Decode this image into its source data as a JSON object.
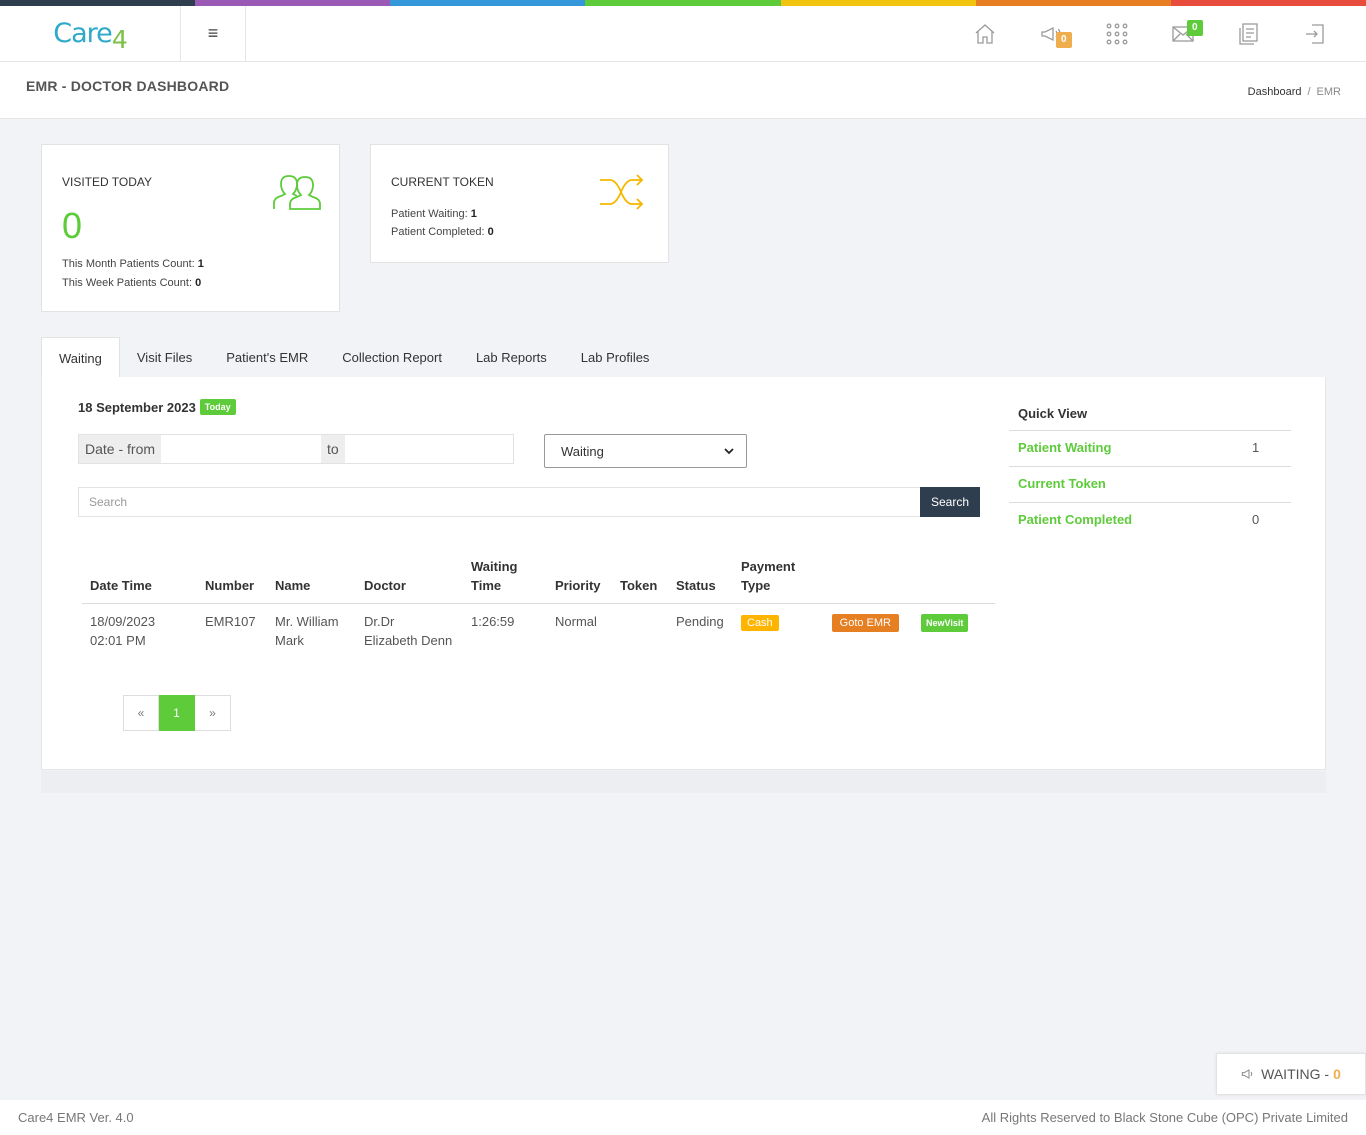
{
  "brand": {
    "logo_text": "Care",
    "logo_suffix": "4",
    "strip_colors": [
      "#2f3e4e",
      "#9b59b6",
      "#3498db",
      "#5ecb3b",
      "#f1c40f",
      "#e67e22",
      "#e74c3c"
    ]
  },
  "topbar": {
    "menu_icon": "≡",
    "announce_count": "0",
    "messages_count": "0"
  },
  "header": {
    "title": "EMR - DOCTOR DASHBOARD",
    "breadcrumb": {
      "first": "Dashboard",
      "separator": "/",
      "current": "EMR"
    }
  },
  "stats": {
    "visited": {
      "title": "VISITED TODAY",
      "count": "0",
      "month_label": "This Month Patients Count:",
      "month_value": "1",
      "week_label": "This Week Patients Count:",
      "week_value": "0"
    },
    "token": {
      "title": "CURRENT TOKEN",
      "waiting_label": "Patient Waiting:",
      "waiting_value": "1",
      "completed_label": "Patient Completed:",
      "completed_value": "0"
    }
  },
  "tabs": [
    "Waiting",
    "Visit Files",
    "Patient's EMR",
    "Collection Report",
    "Lab Reports",
    "Lab Profiles"
  ],
  "waiting": {
    "date": "18 September 2023",
    "today_label": "Today",
    "date_from_label": "Date - from",
    "date_to_label": "to",
    "status_value": "Waiting",
    "search_placeholder": "Search",
    "search_button": "Search",
    "columns": {
      "datetime": "Date Time",
      "number": "Number",
      "name": "Name",
      "doctor": "Doctor",
      "waiting_time_1": "Waiting",
      "waiting_time_2": "Time",
      "priority": "Priority",
      "token": "Token",
      "status": "Status",
      "payment_1": "Payment",
      "payment_2": "Type"
    },
    "row": {
      "date": "18/09/2023",
      "time": "02:01 PM",
      "number": "EMR107",
      "name_1": "Mr. William",
      "name_2": "Mark",
      "doctor_1": "Dr.Dr",
      "doctor_2": "Elizabeth Denn",
      "waiting_time": "1:26:59",
      "priority": "Normal",
      "token": "",
      "status": "Pending",
      "payment": "Cash",
      "goto_label": "Goto EMR",
      "newvisit_label": "NewVisit"
    },
    "pagination": {
      "prev": "«",
      "page": "1",
      "next": "»"
    }
  },
  "quick_view": {
    "title": "Quick View",
    "rows": [
      {
        "label": "Patient Waiting",
        "value": "1"
      },
      {
        "label": "Current Token",
        "value": ""
      },
      {
        "label": "Patient Completed",
        "value": "0"
      }
    ]
  },
  "waiting_widget": {
    "label": "WAITING -",
    "count": "0"
  },
  "footer": {
    "version": "Care4 EMR Ver. 4.0",
    "rights": "All Rights Reserved to Black Stone Cube (OPC) Private Limited"
  }
}
